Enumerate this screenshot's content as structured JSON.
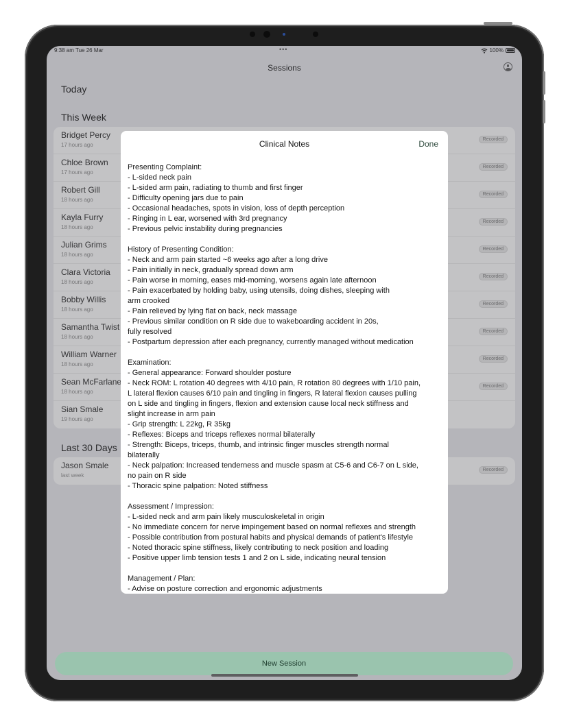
{
  "status_bar": {
    "time": "9:38 am  Tue 26 Mar",
    "dots": "•••",
    "battery": "100%"
  },
  "header": {
    "title": "Sessions"
  },
  "sections": {
    "today": "Today",
    "this_week": "This Week",
    "last_30_days": "Last 30 Days"
  },
  "this_week_rows": [
    {
      "name": "Bridget Percy",
      "time": "17 hours ago",
      "badge": "Recorded"
    },
    {
      "name": "Chloe Brown",
      "time": "17 hours ago",
      "badge": "Recorded"
    },
    {
      "name": "Robert Gill",
      "time": "18 hours ago",
      "badge": "Recorded"
    },
    {
      "name": "Kayla Furry",
      "time": "18 hours ago",
      "badge": "Recorded"
    },
    {
      "name": "Julian Grims",
      "time": "18 hours ago",
      "badge": "Recorded"
    },
    {
      "name": "Clara Victoria",
      "time": "18 hours ago",
      "badge": "Recorded"
    },
    {
      "name": "Bobby Willis",
      "time": "18 hours ago",
      "badge": "Recorded"
    },
    {
      "name": "Samantha Twist",
      "time": "18 hours ago",
      "badge": "Recorded"
    },
    {
      "name": "William Warner",
      "time": "18 hours ago",
      "badge": "Recorded"
    },
    {
      "name": "Sean McFarlane",
      "time": "18 hours ago",
      "badge": "Recorded"
    },
    {
      "name": "Sian Smale",
      "time": "19 hours ago",
      "badge": ""
    }
  ],
  "last_30_rows": [
    {
      "name": "Jason Smale",
      "time": "last week",
      "badge": "Recorded"
    }
  ],
  "new_session_label": "New Session",
  "modal": {
    "title": "Clinical Notes",
    "done_label": "Done",
    "lines": [
      "Presenting Complaint:",
      "- L-sided neck pain",
      "- L-sided arm pain, radiating to thumb and first finger",
      "- Difficulty opening jars due to pain",
      "- Occasional headaches, spots in vision, loss of depth perception",
      "- Ringing in L ear, worsened with 3rd pregnancy",
      "- Previous pelvic instability during pregnancies",
      "",
      "History of Presenting Condition:",
      "- Neck and arm pain started ~6 weeks ago after a long drive",
      "- Pain initially in neck, gradually spread down arm",
      "- Pain worse in morning, eases mid-morning, worsens again late afternoon",
      "- Pain exacerbated by holding baby, using utensils, doing dishes, sleeping with",
      "arm crooked",
      "- Pain relieved by lying flat on back, neck massage",
      "- Previous similar condition on R side due to wakeboarding accident in 20s,",
      "fully resolved",
      "- Postpartum depression after each pregnancy, currently managed without medication",
      "",
      "Examination:",
      "- General appearance: Forward shoulder posture",
      "- Neck ROM: L rotation 40 degrees with 4/10 pain, R rotation 80 degrees with 1/10 pain,",
      "L lateral flexion causes 6/10 pain and tingling in fingers, R lateral flexion causes pulling",
      "on L side and tingling in fingers, flexion and extension cause local neck stiffness and",
      "slight increase in arm pain",
      "- Grip strength: L 22kg, R 35kg",
      "- Reflexes: Biceps and triceps reflexes normal bilaterally",
      "- Strength: Biceps, triceps, thumb, and intrinsic finger muscles strength normal",
      "bilaterally",
      "- Neck palpation: Increased tenderness and muscle spasm at C5-6 and C6-7 on L side,",
      "no pain on R side",
      "- Thoracic spine palpation: Noted stiffness",
      "",
      "Assessment / Impression:",
      "- L-sided neck and arm pain likely musculoskeletal in origin",
      "- No immediate concern for nerve impingement based on normal reflexes and strength",
      "- Possible contribution from postural habits and physical demands of patient's lifestyle",
      "- Noted thoracic spine stiffness, likely contributing to neck position and loading",
      "- Positive upper limb tension tests 1 and 2 on L side, indicating neural tension",
      "",
      "Management / Plan:",
      "- Advise on posture correction and ergonomic adjustments"
    ]
  }
}
